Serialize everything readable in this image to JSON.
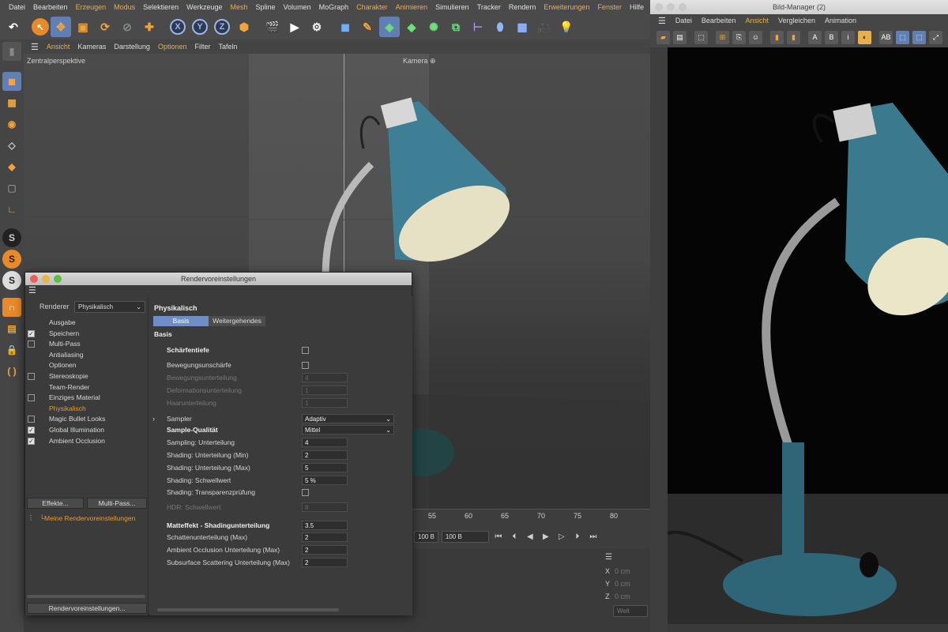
{
  "app": {
    "main_menu": [
      "Datei",
      "Bearbeiten",
      "Erzeugen",
      "Modus",
      "Selektieren",
      "Werkzeuge",
      "Mesh",
      "Spline",
      "Volumen",
      "MoGraph",
      "Charakter",
      "Animieren",
      "Simulieren",
      "Tracker",
      "Rendern",
      "Erweiterungen",
      "Fenster",
      "Hilfe"
    ],
    "highlighted_menus": [
      "Erzeugen",
      "Modus",
      "Mesh",
      "Charakter",
      "Animieren",
      "Erweiterungen",
      "Fenster"
    ]
  },
  "toolbar": {
    "axis_x": "X",
    "axis_y": "Y",
    "axis_z": "Z"
  },
  "viewport": {
    "menu": [
      "Ansicht",
      "Kameras",
      "Darstellung",
      "Optionen",
      "Filter",
      "Tafeln"
    ],
    "perspective_label": "Zentralperspektive",
    "camera_label": "Kamera"
  },
  "timeline": {
    "ticks": [
      "55",
      "60",
      "65",
      "70",
      "75",
      "80"
    ],
    "frame_start": "100 B",
    "frame_end": "100 B"
  },
  "coordinates": {
    "x_label": "X",
    "x_value": "0 cm",
    "y_label": "Y",
    "y_value": "0 cm",
    "z_label": "Z",
    "z_value": "0 cm",
    "space": "Welt"
  },
  "dialog": {
    "title": "Rendervoreinstellungen",
    "renderer_label": "Renderer",
    "renderer_value": "Physikalisch",
    "nav_items": [
      {
        "label": "Ausgabe",
        "checkbox": "none"
      },
      {
        "label": "Speichern",
        "checkbox": "on"
      },
      {
        "label": "Multi-Pass",
        "checkbox": "off"
      },
      {
        "label": "Antialiasing",
        "checkbox": "none"
      },
      {
        "label": "Optionen",
        "checkbox": "none"
      },
      {
        "label": "Stereoskopie",
        "checkbox": "off"
      },
      {
        "label": "Team-Render",
        "checkbox": "none"
      },
      {
        "label": "Einziges Material",
        "checkbox": "off"
      },
      {
        "label": "Physikalisch",
        "checkbox": "none",
        "active": true
      },
      {
        "label": "Magic Bullet Looks",
        "checkbox": "off"
      },
      {
        "label": "Global Illumination",
        "checkbox": "on"
      },
      {
        "label": "Ambient Occlusion",
        "checkbox": "on"
      }
    ],
    "effects_button": "Effekte...",
    "multipass_button": "Multi-Pass...",
    "preset_item": "Meine Rendervoreinstellungen",
    "presets_button": "Rendervoreinstellungen...",
    "section_title": "Physikalisch",
    "tab_basis": "Basis",
    "tab_advanced": "Weitergehendes",
    "group_label": "Basis",
    "params": [
      {
        "label": "Schärfentiefe",
        "type": "checkbox",
        "bold": true
      },
      {
        "label": "Bewegungsunschärfe",
        "type": "checkbox"
      },
      {
        "label": "Bewegungsunterteilung",
        "type": "value",
        "value": "4",
        "dim": true
      },
      {
        "label": "Deformationsunterteilung",
        "type": "value",
        "value": "1",
        "dim": true
      },
      {
        "label": "Haarunterteilung",
        "type": "value",
        "value": "1",
        "dim": true
      },
      {
        "label": "Sampler",
        "type": "dropdown",
        "value": "Adaptiv"
      },
      {
        "label": "Sample-Qualität",
        "type": "dropdown",
        "value": "Mittel",
        "bold": true
      },
      {
        "label": "Sampling: Unterteilung",
        "type": "value",
        "value": "4"
      },
      {
        "label": "Shading: Unterteilung (Min)",
        "type": "value",
        "value": "2"
      },
      {
        "label": "Shading: Unterteilung (Max)",
        "type": "value",
        "value": "5"
      },
      {
        "label": "Shading: Schwellwert",
        "type": "value",
        "value": "5 %"
      },
      {
        "label": "Shading: Transparenzprüfung",
        "type": "checkbox"
      },
      {
        "label": "HDR: Schwellwert",
        "type": "value",
        "value": "8",
        "dim": true
      },
      {
        "label": "Matteffekt - Shadingunterteilung",
        "type": "value",
        "value": "3.5",
        "bold": true
      },
      {
        "label": "Schattenunterteilung (Max)",
        "type": "value",
        "value": "2"
      },
      {
        "label": "Ambient Occlusion Unterteilung (Max)",
        "type": "value",
        "value": "2"
      },
      {
        "label": "Subsurface Scattering Unterteilung (Max)",
        "type": "value",
        "value": "2"
      }
    ]
  },
  "picture_viewer": {
    "title": "Bild-Manager (2)",
    "menu": [
      "Datei",
      "Bearbeiten",
      "Ansicht",
      "Vergleichen",
      "Animation"
    ],
    "highlighted_menu": "Ansicht"
  }
}
